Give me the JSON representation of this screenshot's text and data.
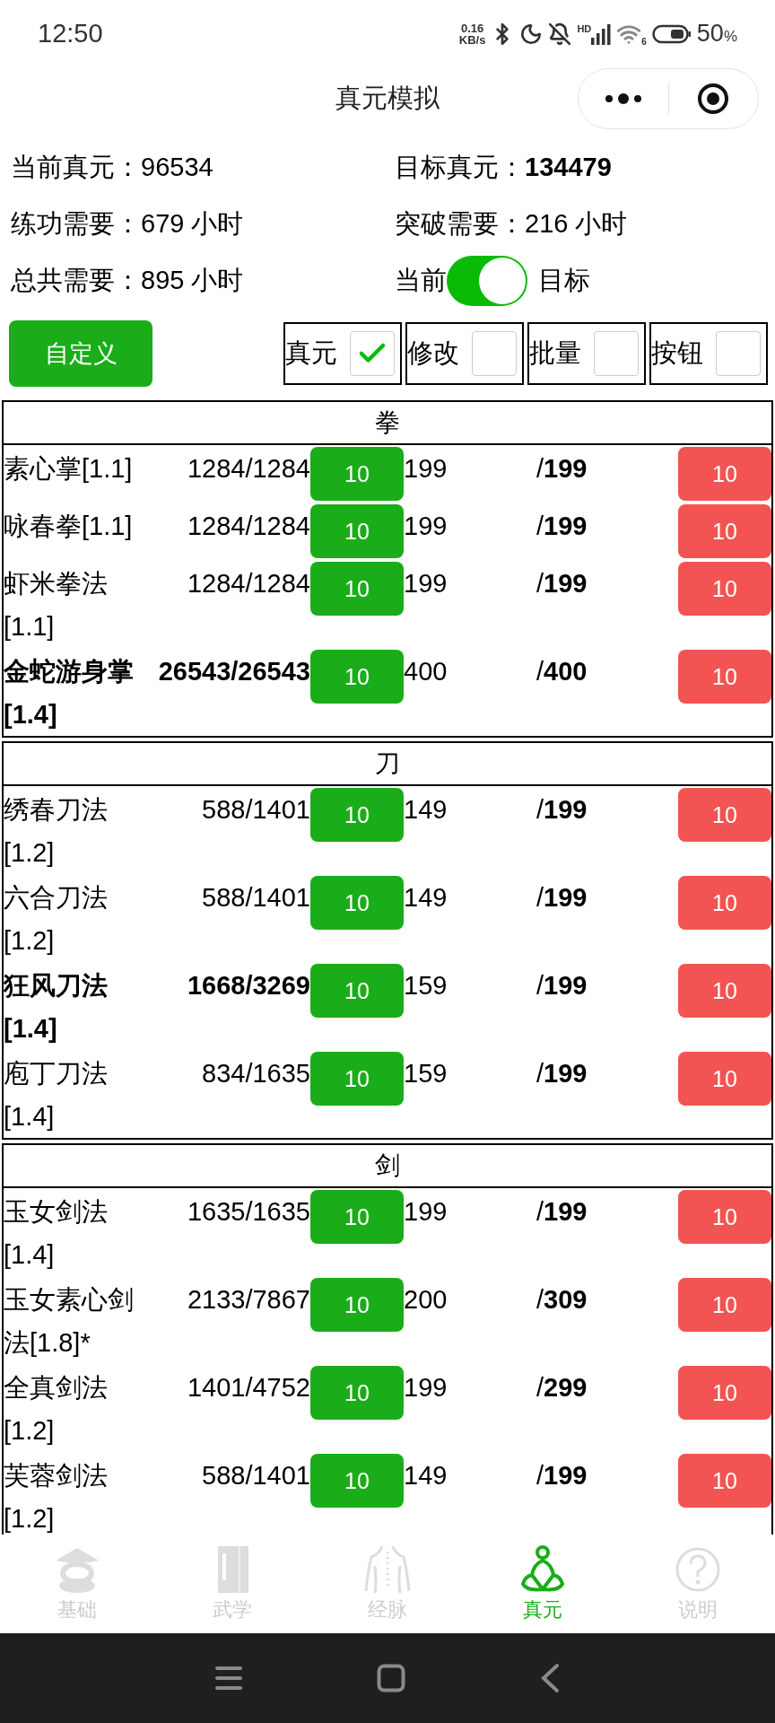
{
  "status_bar": {
    "time": "12:50",
    "net_speed_value": "0.16",
    "net_speed_unit": "KB/s",
    "signal_badge": "HD",
    "wifi_badge": "6",
    "battery": "50",
    "battery_unit": "%"
  },
  "title_bar": {
    "title": "真元模拟"
  },
  "stats": [
    {
      "label": "当前真元：",
      "value": "96534",
      "bold": false
    },
    {
      "label": "目标真元：",
      "value": "134479",
      "bold": true
    },
    {
      "label": "练功需要：",
      "value": "679 小时",
      "bold": false
    },
    {
      "label": "突破需要：",
      "value": "216 小时",
      "bold": false
    },
    {
      "label": "总共需要：",
      "value": "895 小时",
      "bold": false
    }
  ],
  "mode_switch": {
    "left_label": "当前",
    "right_label": "目标",
    "on": true
  },
  "custom_button": "自定义",
  "options": [
    {
      "label": "真元",
      "checked": true
    },
    {
      "label": "修改",
      "checked": false
    },
    {
      "label": "批量",
      "checked": false
    },
    {
      "label": "按钮",
      "checked": false
    }
  ],
  "sections": [
    {
      "title": "拳",
      "rows": [
        {
          "name": "素心掌[1.1]",
          "progress": "1284/1284",
          "add": "10",
          "current": "199",
          "max": "/**199**",
          "remove": "10",
          "bold": false
        },
        {
          "name": "咏春拳[1.1]",
          "progress": "1284/1284",
          "add": "10",
          "current": "199",
          "max": "/**199**",
          "remove": "10",
          "bold": false
        },
        {
          "name": "虾米拳法[1.1]",
          "progress": "1284/1284",
          "add": "10",
          "current": "199",
          "max": "/**199**",
          "remove": "10",
          "bold": false
        },
        {
          "name": "金蛇游身掌[1.4]",
          "progress": "26543/26543",
          "add": "10",
          "current": "400",
          "max": "/**400**",
          "remove": "10",
          "bold": true
        }
      ]
    },
    {
      "title": "刀",
      "rows": [
        {
          "name": "绣春刀法[1.2]",
          "progress": "588/1401",
          "add": "10",
          "current": "149",
          "max": "/**199**",
          "remove": "10",
          "bold": false
        },
        {
          "name": "六合刀法[1.2]",
          "progress": "588/1401",
          "add": "10",
          "current": "149",
          "max": "/**199**",
          "remove": "10",
          "bold": false
        },
        {
          "name": "狂风刀法[1.4]",
          "progress": "1668/3269",
          "add": "10",
          "current": "159",
          "max": "/**199**",
          "remove": "10",
          "bold": true
        },
        {
          "name": "庖丁刀法[1.4]",
          "progress": "834/1635",
          "add": "10",
          "current": "159",
          "max": "/**199**",
          "remove": "10",
          "bold": false
        }
      ]
    },
    {
      "title": "剑",
      "rows": [
        {
          "name": "玉女剑法[1.4]",
          "progress": "1635/1635",
          "add": "10",
          "current": "199",
          "max": "/**199**",
          "remove": "10",
          "bold": false
        },
        {
          "name": "玉女素心剑法[1.8]*",
          "progress": "2133/7867",
          "add": "10",
          "current": "200",
          "max": "/**309**",
          "remove": "10",
          "bold": false
        },
        {
          "name": "全真剑法[1.2]",
          "progress": "1401/4752",
          "add": "10",
          "current": "199",
          "max": "/**299**",
          "remove": "10",
          "bold": false
        },
        {
          "name": "芙蓉剑法[1.2]",
          "progress": "588/1401",
          "add": "10",
          "current": "149",
          "max": "/**199**",
          "remove": "10",
          "bold": false
        }
      ]
    }
  ],
  "bottom_nav": [
    {
      "label": "基础",
      "selected": false,
      "kind": "hat"
    },
    {
      "label": "武学",
      "selected": false,
      "kind": "book"
    },
    {
      "label": "经脉",
      "selected": false,
      "kind": "body"
    },
    {
      "label": "真元",
      "selected": true,
      "kind": "meditation"
    },
    {
      "label": "说明",
      "selected": false,
      "kind": "help"
    }
  ]
}
